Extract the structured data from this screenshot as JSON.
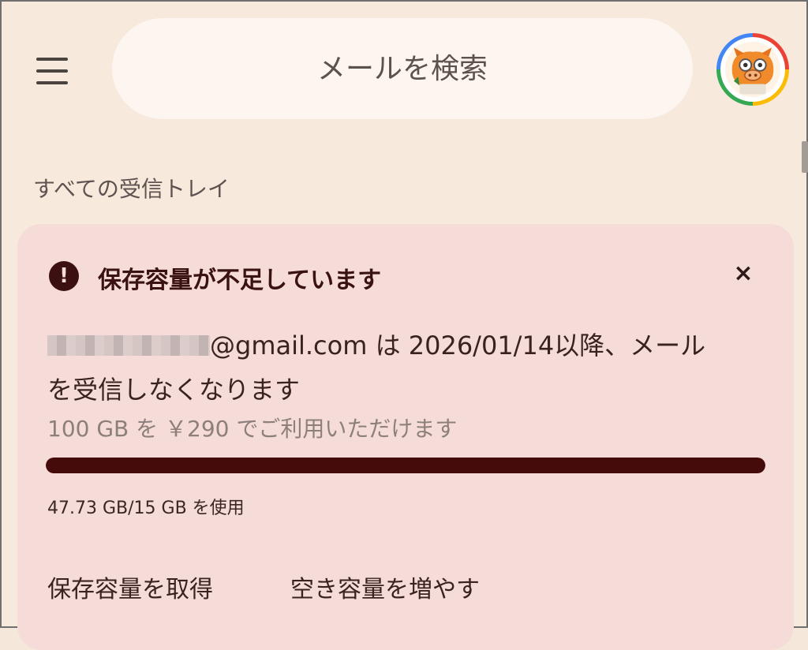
{
  "search": {
    "placeholder": "メールを検索"
  },
  "inbox": {
    "label": "すべての受信トレイ"
  },
  "storage_card": {
    "title": "保存容量が不足しています",
    "close_symbol": "×",
    "alert_symbol": "!",
    "message_email": "@gmail.com は 2026/01/14以降、メール",
    "message_line2": "を受信しなくなります",
    "plan_offer": "100 GB を ￥290 でご利用いただけます",
    "usage_text": "47.73 GB/15 GB を使用",
    "usage_fraction": 1.0,
    "actions": {
      "get_storage": "保存容量を取得",
      "free_up": "空き容量を増やす"
    }
  },
  "colors": {
    "background": "#f7e9db",
    "card": "#f6dcd8",
    "progress_fill": "#450b0b",
    "alert_icon": "#3c1010"
  },
  "icons": {
    "menu": "hamburger-menu-icon",
    "alert": "exclamation-circle-icon",
    "close": "close-icon",
    "avatar": "pig-mascot-avatar"
  }
}
